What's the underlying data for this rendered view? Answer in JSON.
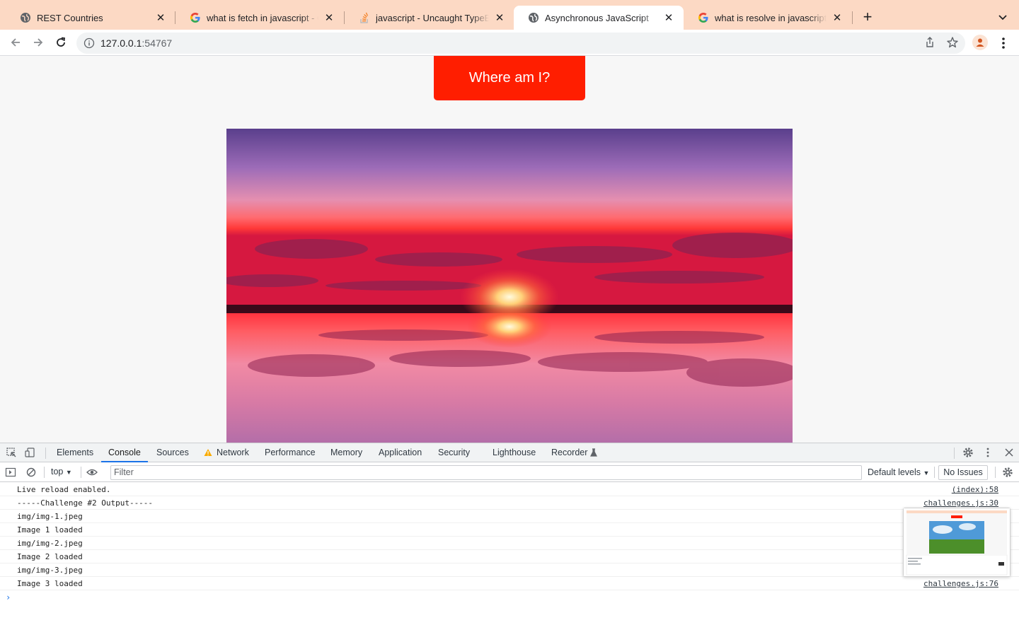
{
  "browser": {
    "tabs": [
      {
        "title": "REST Countries",
        "favicon": "globe-icon",
        "active": false
      },
      {
        "title": "what is fetch in javascript - Google Search",
        "favicon": "google-icon",
        "active": false
      },
      {
        "title": "javascript - Uncaught TypeError",
        "favicon": "stackoverflow-icon",
        "active": false
      },
      {
        "title": "Asynchronous JavaScript",
        "favicon": "globe-icon",
        "active": true
      },
      {
        "title": "what is resolve in javascript - Google Search",
        "favicon": "google-icon",
        "active": false
      }
    ],
    "url_host": "127.0.0.1",
    "url_port": ":54767"
  },
  "page": {
    "button_label": "Where am I?"
  },
  "devtools": {
    "tabs": [
      "Elements",
      "Console",
      "Sources",
      "Network",
      "Performance",
      "Memory",
      "Application",
      "Security",
      "Lighthouse",
      "Recorder"
    ],
    "active_tab": "Console",
    "context": "top",
    "filter_placeholder": "Filter",
    "levels": "Default levels",
    "issues": "No Issues",
    "logs": [
      {
        "message": "Live reload enabled.",
        "source": "(index):58"
      },
      {
        "message": "-----Challenge #2 Output-----",
        "source": "challenges.js:30"
      },
      {
        "message": "img/img-1.jpeg",
        "source": ""
      },
      {
        "message": "Image 1 loaded",
        "source": ""
      },
      {
        "message": "img/img-2.jpeg",
        "source": ""
      },
      {
        "message": "Image 2 loaded",
        "source": ""
      },
      {
        "message": "img/img-3.jpeg",
        "source": ""
      },
      {
        "message": "Image 3 loaded",
        "source": "challenges.js:76"
      }
    ]
  },
  "colors": {
    "tabstrip": "#fcd9c4",
    "button": "#ff1e00",
    "devtools_accent": "#1a73e8"
  }
}
